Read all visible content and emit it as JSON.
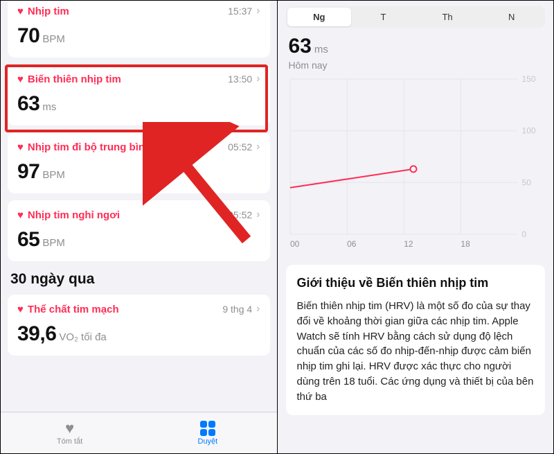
{
  "left": {
    "cards": [
      {
        "title": "Nhịp tim",
        "time": "15:37",
        "value": "70",
        "unit": "BPM"
      },
      {
        "title": "Biến thiên nhịp tim",
        "time": "13:50",
        "value": "63",
        "unit": "ms"
      },
      {
        "title": "Nhịp tim đi bộ trung bình",
        "time": "05:52",
        "value": "97",
        "unit": "BPM"
      },
      {
        "title": "Nhịp tim nghỉ ngơi",
        "time": "05:52",
        "value": "65",
        "unit": "BPM"
      }
    ],
    "section_heading": "30 ngày qua",
    "section_cards": [
      {
        "title": "Thể chất tim mạch",
        "time": "9 thg 4",
        "value": "39,6",
        "unit": "VO₂ tối đa"
      }
    ],
    "tabs": {
      "summary": "Tóm tắt",
      "browse": "Duyệt"
    }
  },
  "right": {
    "segments": [
      "Ng",
      "T",
      "Th",
      "N"
    ],
    "hero_value": "63",
    "hero_unit": "ms",
    "hero_sub": "Hôm nay",
    "info_title": "Giới thiệu về Biến thiên nhịp tim",
    "info_body": "Biến thiên nhịp tim (HRV) là một số đo của sự thay đổi về khoảng thời gian giữa các nhịp tim. Apple Watch sẽ tính HRV bằng cách sử dụng độ lệch chuẩn của các số đo nhịp-đến-nhịp được cảm biến nhịp tim ghi lại. HRV được xác thực cho người dùng trên 18 tuổi. Các ứng dụng và thiết bị của bên thứ ba"
  },
  "chart_data": {
    "type": "line",
    "x": [
      0,
      13
    ],
    "values": [
      45,
      63
    ],
    "xticks": [
      "00",
      "06",
      "12",
      "18"
    ],
    "yticks": [
      0,
      50,
      100,
      150
    ],
    "xlim": [
      0,
      24
    ],
    "ylim": [
      0,
      150
    ],
    "xlabel": "",
    "ylabel": "",
    "title": ""
  }
}
